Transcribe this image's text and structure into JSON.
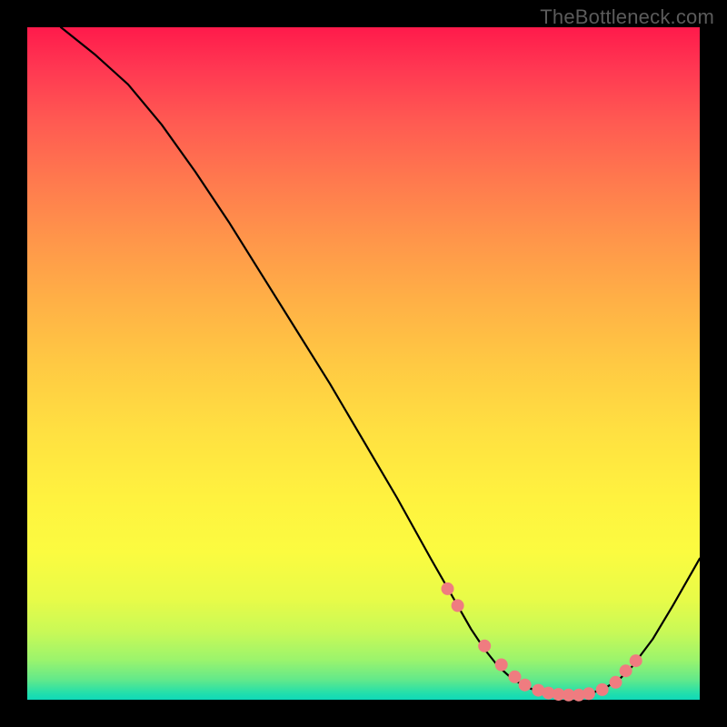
{
  "watermark": "TheBottleneck.com",
  "colors": {
    "frame": "#000000",
    "curve": "#000000",
    "marker": "#ef7c80"
  },
  "chart_data": {
    "type": "line",
    "title": "",
    "xlabel": "",
    "ylabel": "",
    "xlim": [
      0,
      100
    ],
    "ylim": [
      0,
      100
    ],
    "grid": false,
    "legend": false,
    "series": [
      {
        "name": "bottleneck-curve",
        "x": [
          5,
          10,
          15,
          20,
          25,
          30,
          35,
          40,
          45,
          50,
          55,
          60,
          62,
          64,
          66,
          68,
          70,
          72,
          74,
          76,
          78,
          80,
          82,
          84,
          86,
          88,
          90,
          93,
          96,
          100
        ],
        "values": [
          100,
          96,
          91.5,
          85.5,
          78.5,
          71,
          63,
          55,
          47,
          38.5,
          30,
          21,
          17.5,
          14,
          10.5,
          7.5,
          5,
          3.2,
          2.0,
          1.2,
          0.8,
          0.6,
          0.7,
          1.0,
          1.8,
          3.0,
          5.0,
          9,
          14,
          21
        ]
      }
    ],
    "markers": {
      "name": "highlight-points",
      "x": [
        62.5,
        64,
        68,
        70.5,
        72.5,
        74,
        76,
        77.5,
        79,
        80.5,
        82,
        83.5,
        85.5,
        87.5,
        89,
        90.5
      ],
      "values": [
        16.5,
        14,
        8,
        5.2,
        3.4,
        2.2,
        1.4,
        1.0,
        0.8,
        0.7,
        0.7,
        0.9,
        1.5,
        2.6,
        4.3,
        5.8
      ]
    }
  }
}
